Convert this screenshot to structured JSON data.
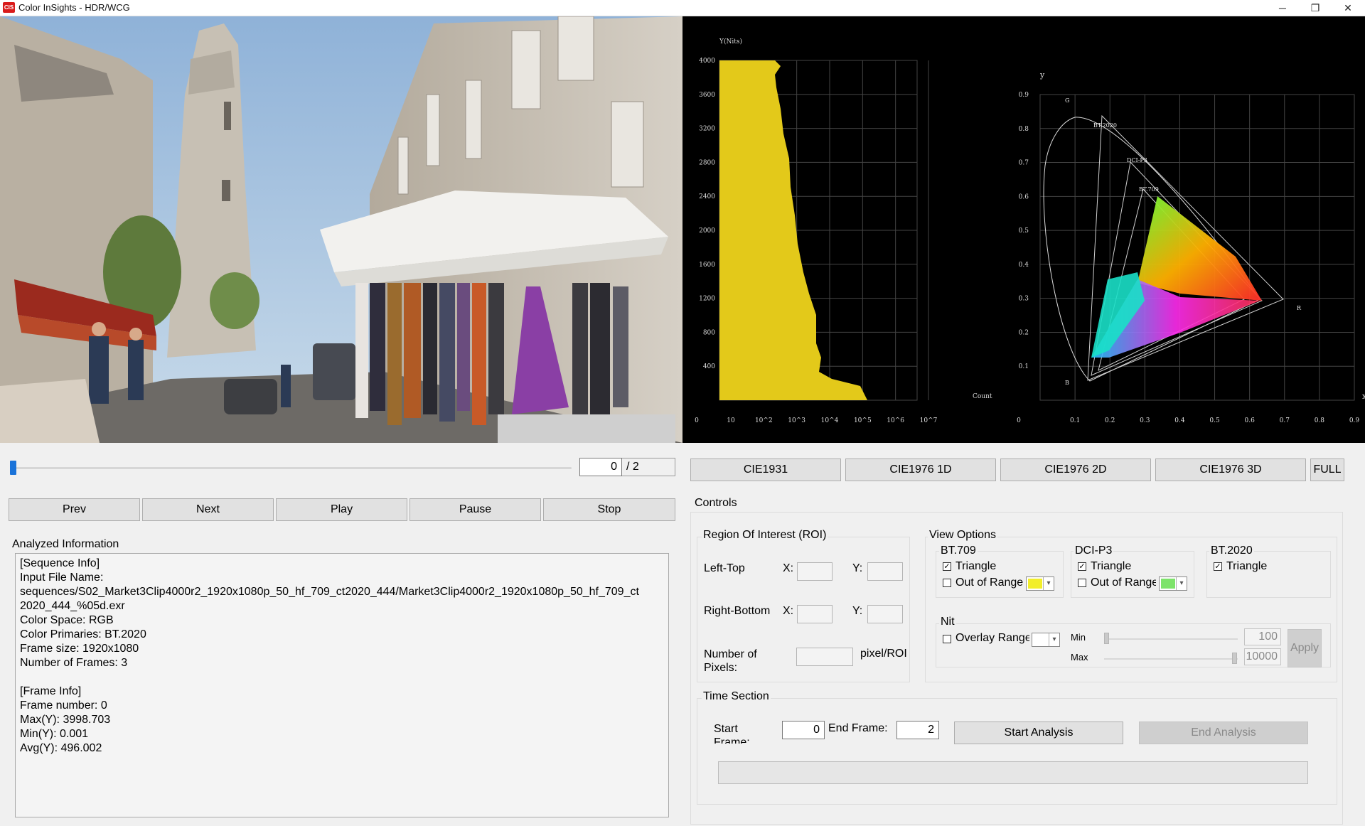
{
  "window": {
    "app_icon_text": "CIS",
    "title": "Color InSights - HDR/WCG",
    "minimize_glyph": "─",
    "restore_glyph": "❐",
    "close_glyph": "✕"
  },
  "histogram": {
    "y_title": "Y(Nits)",
    "x_title": "Count",
    "y_ticks": [
      "4000",
      "3600",
      "3200",
      "2800",
      "2400",
      "2000",
      "1600",
      "1200",
      "800",
      "400"
    ],
    "x_ticks": [
      "0",
      "10",
      "10^2",
      "10^3",
      "10^4",
      "10^5",
      "10^6",
      "10^7"
    ],
    "fill_color": "#e3c91a"
  },
  "chromaticity": {
    "y_axis_label": "y",
    "x_axis_label": "x",
    "y_ticks": [
      "0.9",
      "0.8",
      "0.7",
      "0.6",
      "0.5",
      "0.4",
      "0.3",
      "0.2",
      "0.1"
    ],
    "x_ticks": [
      "0",
      "0.1",
      "0.2",
      "0.3",
      "0.4",
      "0.5",
      "0.6",
      "0.7",
      "0.8",
      "0.9"
    ],
    "labels": {
      "G": "G",
      "R": "R",
      "B": "B",
      "bt2020": "BT.2020",
      "dcip3": "DCI-P3",
      "bt709": "BT.709"
    }
  },
  "frame": {
    "current": "0",
    "total": "/ 2",
    "position": 0.0
  },
  "tabs": [
    {
      "label": "CIE1931"
    },
    {
      "label": "CIE1976 1D"
    },
    {
      "label": "CIE1976 2D"
    },
    {
      "label": "CIE1976 3D"
    },
    {
      "label": "FULL"
    }
  ],
  "playback": [
    {
      "label": "Prev"
    },
    {
      "label": "Next"
    },
    {
      "label": "Play"
    },
    {
      "label": "Pause"
    },
    {
      "label": "Stop"
    }
  ],
  "info": {
    "title": "Analyzed Information",
    "lines": [
      "[Sequence Info]",
      "Input File Name:",
      "sequences/S02_Market3Clip4000r2_1920x1080p_50_hf_709_ct2020_444/Market3Clip4000r2_1920x1080p_50_hf_709_ct",
      "2020_444_%05d.exr",
      "Color Space: RGB",
      "Color Primaries: BT.2020",
      "Frame size: 1920x1080",
      "Number of Frames: 3",
      "",
      "[Frame Info]",
      "Frame number: 0",
      "Max(Y): 3998.703",
      "Min(Y): 0.001",
      "Avg(Y): 496.002"
    ]
  },
  "controls": {
    "title": "Controls",
    "roi": {
      "title": "Region Of Interest (ROI)",
      "left_top": "Left-Top",
      "right_bottom": "Right-Bottom",
      "x_label": "X:",
      "y_label": "Y:",
      "num_pixels": "Number of Pixels:",
      "pixel_unit": "pixel/ROI"
    },
    "view": {
      "title": "View Options",
      "bt709": {
        "title": "BT.709",
        "triangle": "Triangle",
        "triangle_checked": "✓",
        "out_of_range": "Out of Range",
        "color": "#f2ee2a"
      },
      "dcip3": {
        "title": "DCI-P3",
        "triangle": "Triangle",
        "triangle_checked": "✓",
        "out_of_range": "Out of Range",
        "color": "#7de36a"
      },
      "bt2020": {
        "title": "BT.2020",
        "triangle": "Triangle",
        "triangle_checked": "✓"
      },
      "nit": {
        "title": "Nit",
        "overlay": "Overlay Range",
        "min_label": "Min",
        "max_label": "Max",
        "min_value": "100",
        "max_value": "10000",
        "apply": "Apply"
      }
    },
    "time": {
      "title": "Time Section",
      "start_label": "Start Frame:",
      "start_value": "0",
      "end_label": "End Frame:",
      "end_value": "2",
      "start_button": "Start Analysis",
      "end_button": "End Analysis"
    }
  }
}
